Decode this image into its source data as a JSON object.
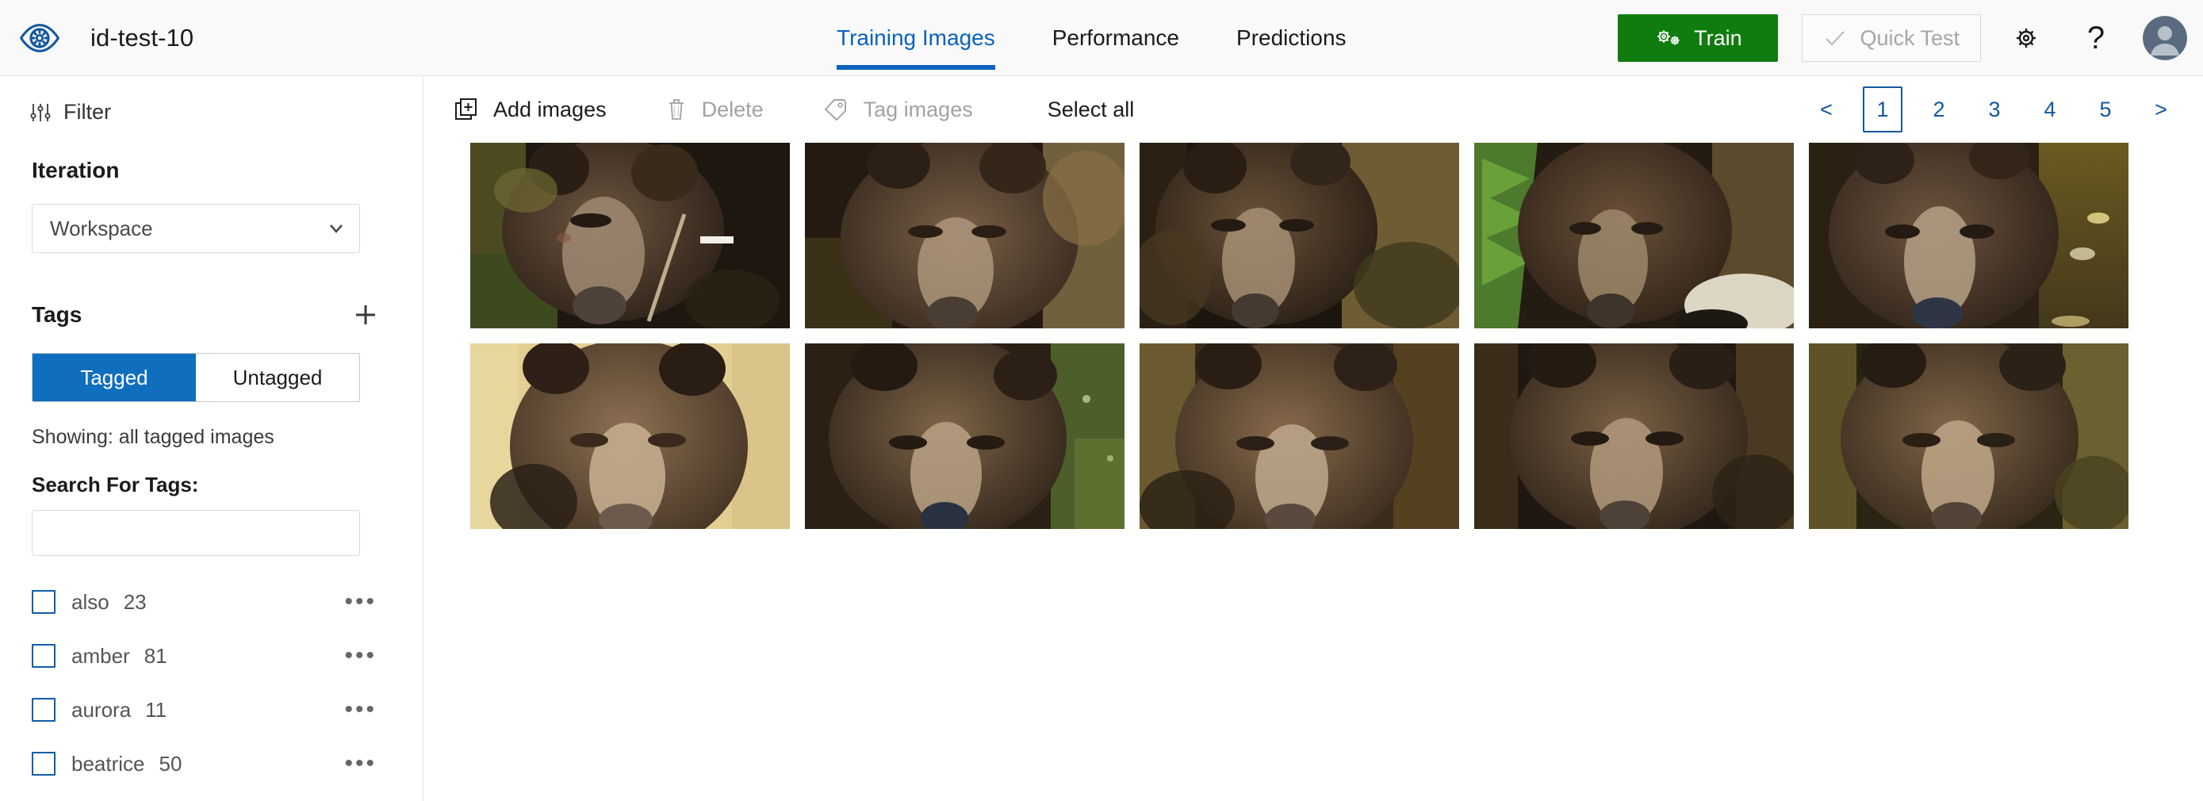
{
  "header": {
    "logo_icon": "eye-gear-icon",
    "project_title": "id-test-10",
    "tabs": [
      {
        "label": "Training Images",
        "active": true
      },
      {
        "label": "Performance",
        "active": false
      },
      {
        "label": "Predictions",
        "active": false
      }
    ],
    "train_button": {
      "label": "Train",
      "icon": "gears-icon",
      "color": "#107c10"
    },
    "quick_test_button": {
      "label": "Quick Test",
      "icon": "check-icon",
      "disabled": true
    },
    "settings_icon": "gear-icon",
    "help_icon": "question-mark-icon",
    "avatar_icon": "user-avatar"
  },
  "sidebar": {
    "filter": {
      "label": "Filter",
      "icon": "filter-sliders-icon"
    },
    "iteration": {
      "title": "Iteration",
      "selected": "Workspace"
    },
    "tags": {
      "title": "Tags",
      "add_icon": "plus-icon",
      "toggle": {
        "tagged": "Tagged",
        "untagged": "Untagged",
        "selected": "Tagged"
      },
      "showing": "Showing: all tagged images",
      "search_label": "Search For Tags:",
      "search_value": "",
      "search_placeholder": "",
      "items": [
        {
          "name": "also",
          "count": "23"
        },
        {
          "name": "amber",
          "count": "81"
        },
        {
          "name": "aurora",
          "count": "11"
        },
        {
          "name": "beatrice",
          "count": "50"
        }
      ]
    }
  },
  "main": {
    "toolbar": {
      "add_images": "Add images",
      "add_images_icon": "add-image-icon",
      "delete": "Delete",
      "delete_icon": "trash-icon",
      "tag_images": "Tag images",
      "tag_images_icon": "tag-icon",
      "select_all": "Select all"
    },
    "pagination": {
      "prev": "<",
      "next": ">",
      "pages": [
        "1",
        "2",
        "3",
        "4",
        "5"
      ],
      "current": "1"
    },
    "images": [
      {
        "alt": "bear-head-in-brush",
        "variant": 1
      },
      {
        "alt": "bear-face-dark-bokeh",
        "variant": 2
      },
      {
        "alt": "bear-face-closeup",
        "variant": 3
      },
      {
        "alt": "bear-with-green-foliage",
        "variant": 4
      },
      {
        "alt": "bear-in-water",
        "variant": 5
      },
      {
        "alt": "bear-face-golden-field",
        "variant": 6
      },
      {
        "alt": "bear-face-green-grass",
        "variant": 7
      },
      {
        "alt": "bear-face-warm-tone",
        "variant": 8
      },
      {
        "alt": "bear-face-shadowed",
        "variant": 9
      },
      {
        "alt": "bear-face-olive-background",
        "variant": 10
      }
    ]
  },
  "colors": {
    "accent": "#0a62bd",
    "train_green": "#107c10",
    "toggle_blue": "#106ebe",
    "pager_blue": "#1257a0"
  }
}
